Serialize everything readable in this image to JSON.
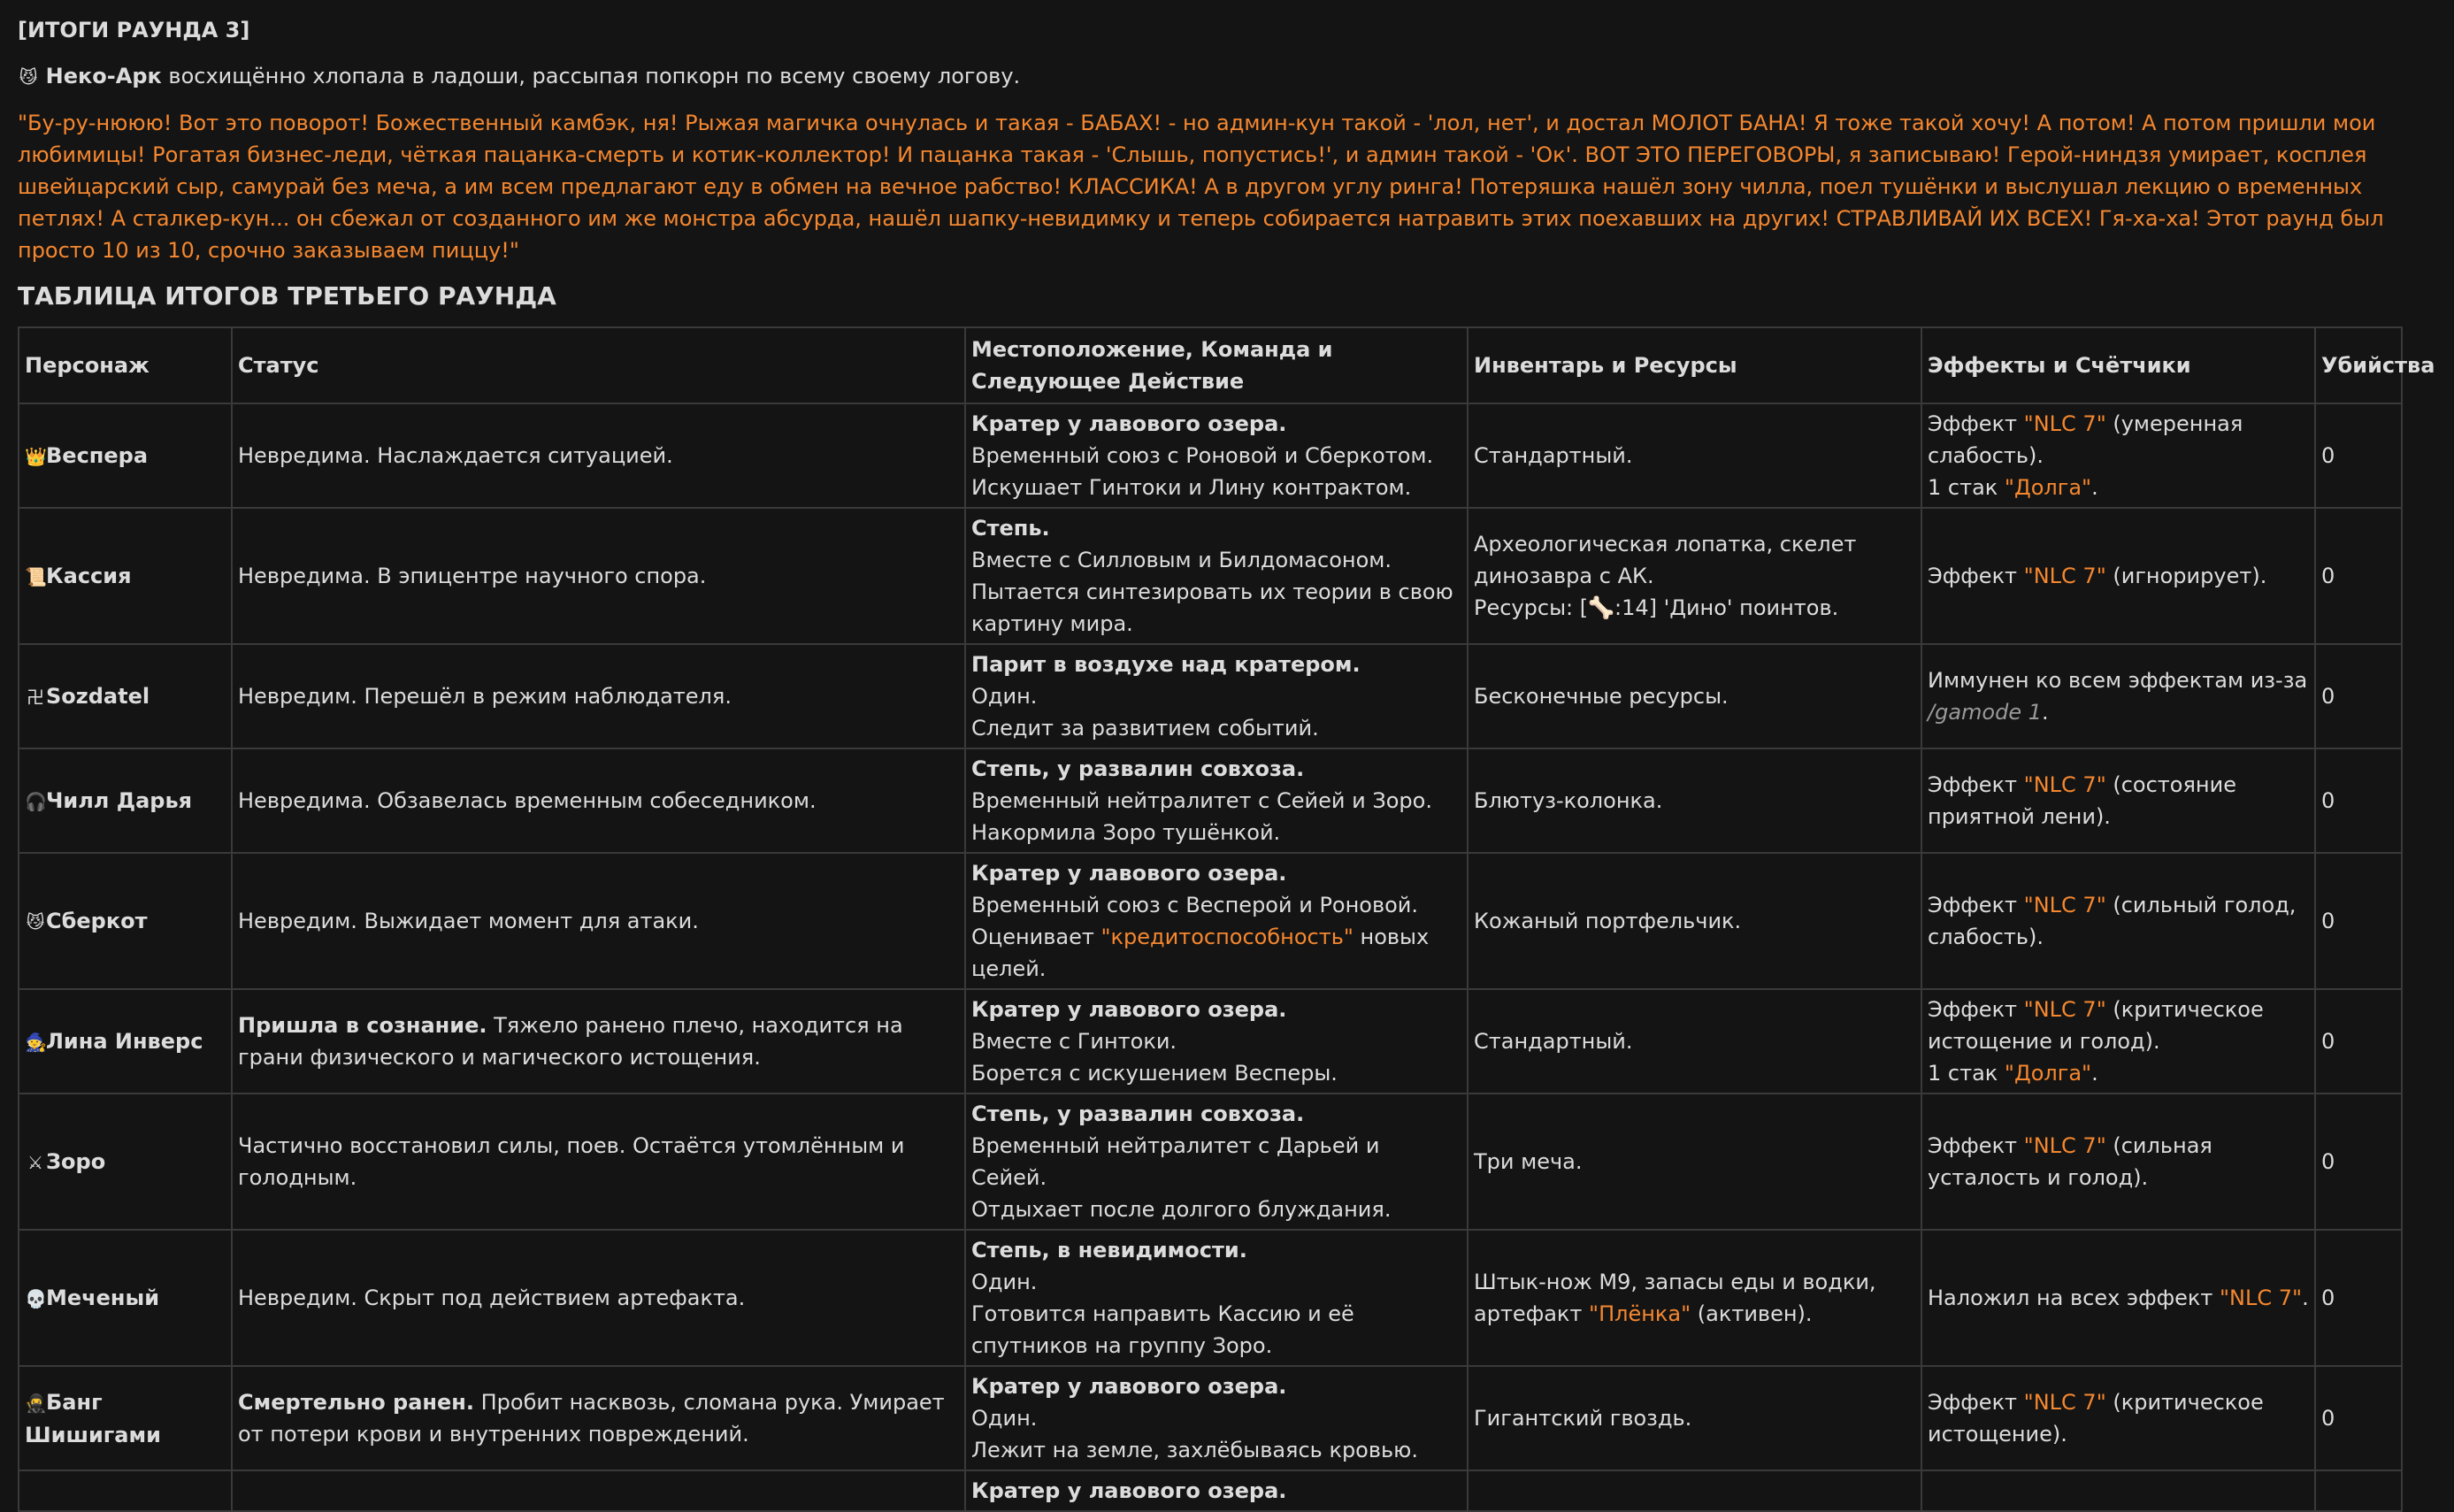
{
  "header": "[ИТОГИ РАУНДА 3]",
  "intro": {
    "icon": "cat-face-icon",
    "icon_glyph": "😼",
    "name": "Неко-Арк",
    "text": " восхищённо хлопала в ладоши, рассыпая попкорн по всему своему логову."
  },
  "speech": "\"Бу-ру-нююю! Вот это поворот! Божественный камбэк, ня! Рыжая магичка очнулась и такая - БАБАХ! - но админ-кун такой - 'лол, нет', и достал МОЛОТ БАНА! Я тоже такой хочу! А потом! А потом пришли мои любимицы! Рогатая бизнес-леди, чёткая пацанка-смерть и котик-коллектор! И пацанка такая - 'Слышь, попустись!', и админ такой - 'Ок'. ВОТ ЭТО ПЕРЕГОВОРЫ, я записываю! Герой-ниндзя умирает, косплея швейцарский сыр, самурай без меча, а им всем предлагают еду в обмен на вечное рабство! КЛАССИКА! А в другом углу ринга! Потеряшка нашёл зону чилла, поел тушёнки и выслушал лекцию о временных петлях! А сталкер-кун... он сбежал от созданного им же монстра абсурда, нашёл шапку-невидимку и теперь собирается натравить этих поехавших на других! СТРАВЛИВАЙ ИХ ВСЕХ! Гя-ха-ха! Этот раунд был просто 10 из 10, срочно заказываем пиццу!\"",
  "table_title": "ТАБЛИЦА ИТОГОВ ТРЕТЬЕГО РАУНДА",
  "colors": {
    "accent": "#f5872f",
    "background": "#141414",
    "text": "#dcdcdc",
    "border": "#3a3a3a"
  },
  "table": {
    "columns": [
      "Персонаж",
      "Статус",
      "Местоположение, Команда и Следующее Действие",
      "Инвентарь и Ресурсы",
      "Эффекты и Счётчики",
      "Убийства"
    ],
    "rows": [
      {
        "icon": "crown-icon",
        "icon_glyph": "👑",
        "name": "Веспера",
        "status_bold": "",
        "status": "Невредима. Наслаждается ситуацией.",
        "location": "Кратер у лавового озера.",
        "loc_lines": [
          [
            {
              "t": "Временный союз с Роновой и Сберкотом."
            }
          ],
          [
            {
              "t": "Искушает Гинтоки и Лину контрактом."
            }
          ]
        ],
        "inventory": [
          [
            {
              "t": "Стандартный."
            }
          ]
        ],
        "effects": [
          [
            {
              "t": "Эффект "
            },
            {
              "t": "\"NLC 7\"",
              "c": "acc"
            },
            {
              "t": " (умеренная слабость)."
            }
          ],
          [
            {
              "t": "1 стак "
            },
            {
              "t": "\"Долга\"",
              "c": "acc"
            },
            {
              "t": "."
            }
          ]
        ],
        "kills": "0"
      },
      {
        "icon": "scroll-icon",
        "icon_glyph": "📜",
        "name": "Кассия",
        "status_bold": "",
        "status": "Невредима. В эпицентре научного спора.",
        "location": "Степь.",
        "loc_lines": [
          [
            {
              "t": "Вместе с Силловым и Билдомасоном."
            }
          ],
          [
            {
              "t": "Пытается синтезировать их теории в свою картину мира."
            }
          ]
        ],
        "inventory": [
          [
            {
              "t": "Археологическая лопатка, скелет динозавра с АК."
            }
          ],
          [
            {
              "t": "Ресурсы: [🦴:14] 'Дино' поинтов."
            }
          ]
        ],
        "effects": [
          [
            {
              "t": "Эффект "
            },
            {
              "t": "\"NLC 7\"",
              "c": "acc"
            },
            {
              "t": " (игнорирует)."
            }
          ]
        ],
        "kills": "0"
      },
      {
        "icon": "symbol-icon",
        "icon_glyph": "卍",
        "name": "Sozdatel",
        "status_bold": "",
        "status": "Невредим. Перешёл в режим наблюдателя.",
        "location": "Парит в воздухе над кратером.",
        "loc_lines": [
          [
            {
              "t": "Один."
            }
          ],
          [
            {
              "t": "Следит за развитием событий."
            }
          ]
        ],
        "inventory": [
          [
            {
              "t": "Бесконечные ресурсы."
            }
          ]
        ],
        "effects": [
          [
            {
              "t": "Иммунен ко всем эффектам из-за "
            },
            {
              "t": "/gamode 1",
              "c": "gm"
            },
            {
              "t": "."
            }
          ]
        ],
        "kills": "0"
      },
      {
        "icon": "headphones-icon",
        "icon_glyph": "🎧",
        "name": "Чилл Дарья",
        "status_bold": "",
        "status": "Невредима. Обзавелась временным собеседником.",
        "location": "Степь, у развалин совхоза.",
        "loc_lines": [
          [
            {
              "t": "Временный нейтралитет с Сейей и Зоро."
            }
          ],
          [
            {
              "t": "Накормила Зоро тушёнкой."
            }
          ]
        ],
        "inventory": [
          [
            {
              "t": "Блютуз-колонка."
            }
          ]
        ],
        "effects": [
          [
            {
              "t": "Эффект "
            },
            {
              "t": "\"NLC 7\"",
              "c": "acc"
            },
            {
              "t": " (состояние приятной лени)."
            }
          ]
        ],
        "kills": "0"
      },
      {
        "icon": "cat-face-icon",
        "icon_glyph": "😼",
        "name": "Сберкот",
        "status_bold": "",
        "status": "Невредим. Выжидает момент для атаки.",
        "location": "Кратер у лавового озера.",
        "loc_lines": [
          [
            {
              "t": "Временный союз с Весперой и Роновой."
            }
          ],
          [
            {
              "t": "Оценивает "
            },
            {
              "t": "\"кредитоспособность\"",
              "c": "acc"
            },
            {
              "t": " новых целей."
            }
          ]
        ],
        "inventory": [
          [
            {
              "t": "Кожаный портфельчик."
            }
          ]
        ],
        "effects": [
          [
            {
              "t": "Эффект "
            },
            {
              "t": "\"NLC 7\"",
              "c": "acc"
            },
            {
              "t": " (сильный голод, слабость)."
            }
          ]
        ],
        "kills": "0"
      },
      {
        "icon": "mage-icon",
        "icon_glyph": "🧙",
        "name": "Лина Инверс",
        "status_bold": "Пришла в сознание.",
        "status": " Тяжело ранено плечо, находится на грани физического и магического истощения.",
        "location": "Кратер у лавового озера.",
        "loc_lines": [
          [
            {
              "t": "Вместе с Гинтоки."
            }
          ],
          [
            {
              "t": "Борется с искушением Весперы."
            }
          ]
        ],
        "inventory": [
          [
            {
              "t": "Стандартный."
            }
          ]
        ],
        "effects": [
          [
            {
              "t": "Эффект "
            },
            {
              "t": "\"NLC 7\"",
              "c": "acc"
            },
            {
              "t": " (критическое истощение и голод)."
            }
          ],
          [
            {
              "t": "1 стак "
            },
            {
              "t": "\"Долга\"",
              "c": "acc"
            },
            {
              "t": "."
            }
          ]
        ],
        "kills": "0"
      },
      {
        "icon": "crossed-swords-icon",
        "icon_glyph": "⚔",
        "name": "Зоро",
        "status_bold": "",
        "status": "Частично восстановил силы, поев. Остаётся утомлённым и голодным.",
        "location": "Степь, у развалин совхоза.",
        "loc_lines": [
          [
            {
              "t": "Временный нейтралитет с Дарьей и Сейей."
            }
          ],
          [
            {
              "t": "Отдыхает после долгого блуждания."
            }
          ]
        ],
        "inventory": [
          [
            {
              "t": "Три меча."
            }
          ]
        ],
        "effects": [
          [
            {
              "t": "Эффект "
            },
            {
              "t": "\"NLC 7\"",
              "c": "acc"
            },
            {
              "t": " (сильная усталость и голод)."
            }
          ]
        ],
        "kills": "0"
      },
      {
        "icon": "skull-icon",
        "icon_glyph": "💀",
        "name": "Меченый",
        "status_bold": "",
        "status": "Невредим. Скрыт под действием артефакта.",
        "location": "Степь, в невидимости.",
        "loc_lines": [
          [
            {
              "t": "Один."
            }
          ],
          [
            {
              "t": "Готовится направить Кассию и её спутников на группу Зоро."
            }
          ]
        ],
        "inventory": [
          [
            {
              "t": "Штык-нож М9, запасы еды и водки, артефакт "
            },
            {
              "t": "\"Плёнка\"",
              "c": "acc"
            },
            {
              "t": " (активен)."
            }
          ]
        ],
        "effects": [
          [
            {
              "t": "Наложил на всех эффект "
            },
            {
              "t": "\"NLC 7\"",
              "c": "acc"
            },
            {
              "t": "."
            }
          ]
        ],
        "kills": "0"
      },
      {
        "icon": "ninja-icon",
        "icon_glyph": "🥷",
        "name": "Банг Шишигами",
        "status_bold": "Смертельно ранен.",
        "status": " Пробит насквозь, сломана рука. Умирает от потери крови и внутренних повреждений.",
        "location": "Кратер у лавового озера.",
        "loc_lines": [
          [
            {
              "t": "Один."
            }
          ],
          [
            {
              "t": "Лежит на земле, захлёбываясь кровью."
            }
          ]
        ],
        "inventory": [
          [
            {
              "t": "Гигантский гвоздь."
            }
          ]
        ],
        "effects": [
          [
            {
              "t": "Эффект "
            },
            {
              "t": "\"NLC 7\"",
              "c": "acc"
            },
            {
              "t": " (критическое истощение)."
            }
          ]
        ],
        "kills": "0"
      },
      {
        "icon": "",
        "icon_glyph": "",
        "name": "",
        "status_bold": "",
        "status": "",
        "location": "Кратер у лавового озера.",
        "loc_lines": [],
        "inventory": [],
        "effects": [],
        "kills": ""
      }
    ]
  }
}
